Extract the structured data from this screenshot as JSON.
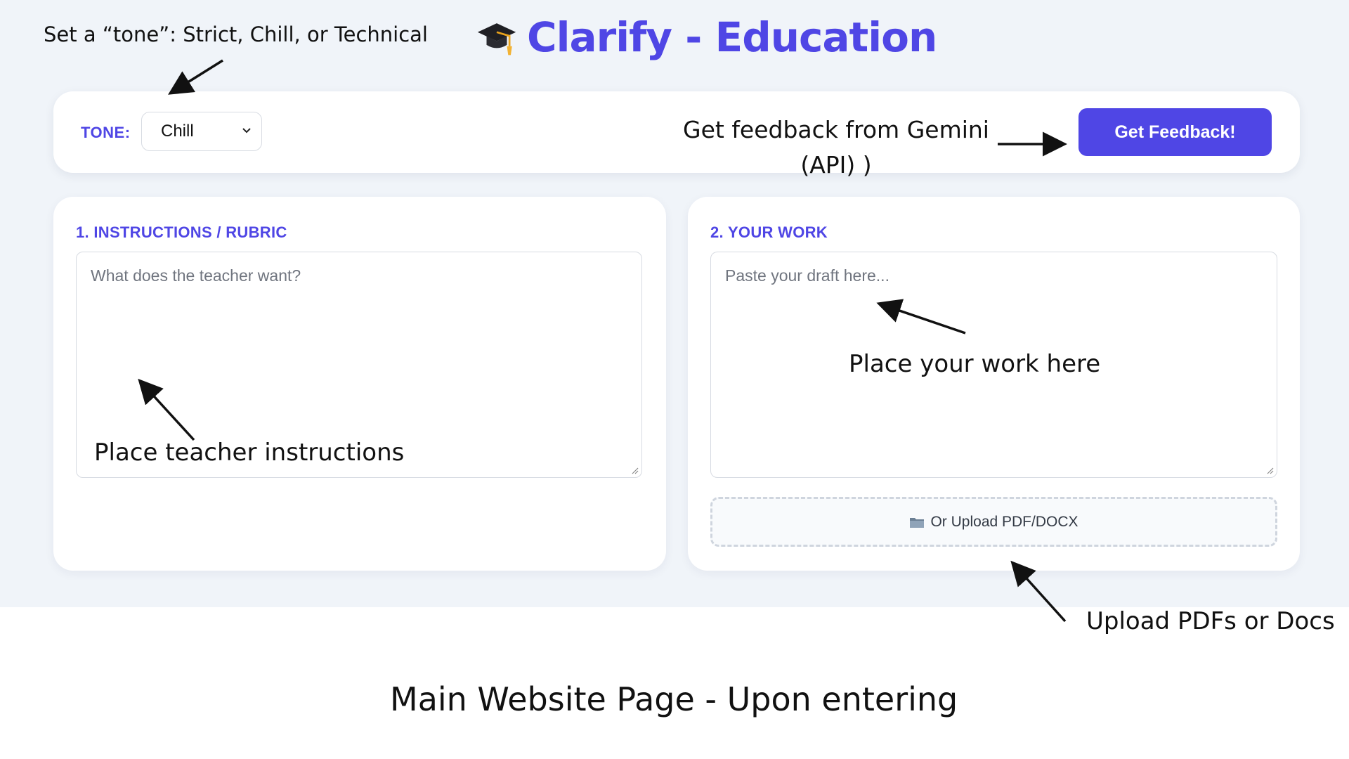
{
  "header": {
    "app_title": "Clarify - Education",
    "title_icon": "graduation-cap-icon"
  },
  "toolbar": {
    "tone_label": "TONE:",
    "tone_selected": "Chill",
    "feedback_button_label": "Get Feedback!"
  },
  "instructions_panel": {
    "label": "1. INSTRUCTIONS / RUBRIC",
    "placeholder": "What does the teacher want?"
  },
  "work_panel": {
    "label": "2. YOUR WORK",
    "placeholder": "Paste your draft here...",
    "upload_label": "Or Upload PDF/DOCX",
    "upload_icon": "folder-icon"
  },
  "annotations": {
    "tone_note": "Set a “tone”: Strict, Chill, or Technical",
    "feedback_note": "Get feedback from Gemini (API) )",
    "work_note": "Place your work here",
    "instructions_note": "Place teacher instructions",
    "upload_note": "Upload PDFs or Docs",
    "caption": "Main Website Page - Upon entering"
  },
  "colors": {
    "accent": "#4f46e5",
    "page_background": "#f0f4f9",
    "card_background": "#ffffff",
    "border": "#d7dbe2"
  }
}
